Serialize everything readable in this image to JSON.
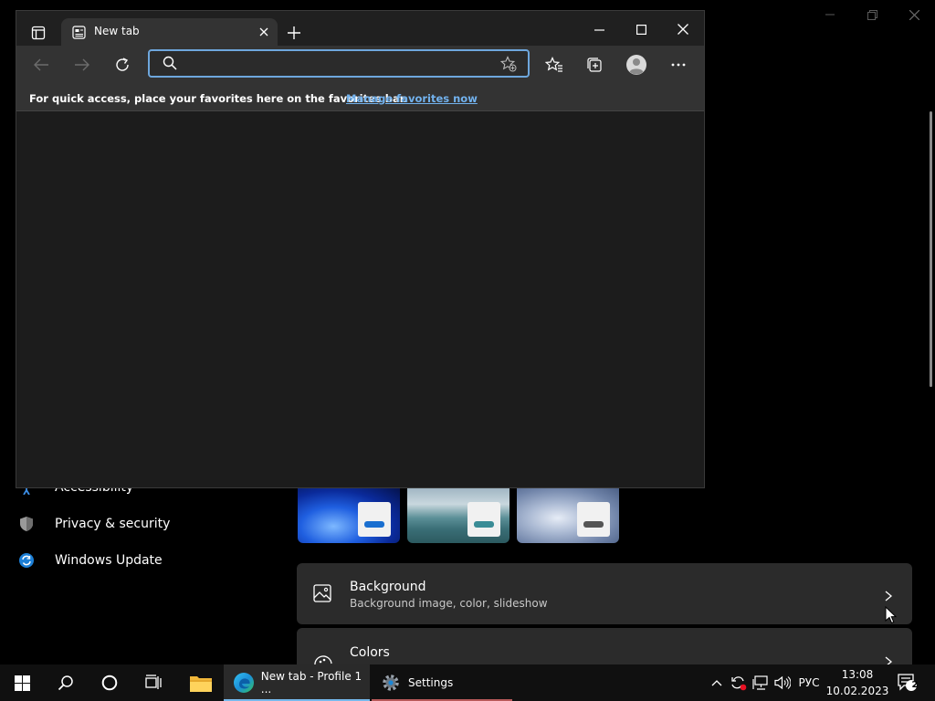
{
  "browser": {
    "tab": {
      "title": "New tab"
    },
    "address": {
      "value": "",
      "placeholder": ""
    },
    "favorites_bar": {
      "message": "For quick access, place your favorites here on the favorites bar.",
      "link": "Manage favorites now"
    }
  },
  "settings": {
    "nav": [
      {
        "label": "Accessibility",
        "icon": "accessibility-icon"
      },
      {
        "label": "Privacy & security",
        "icon": "shield-icon"
      },
      {
        "label": "Windows Update",
        "icon": "update-icon"
      }
    ],
    "cards": [
      {
        "title": "Background",
        "subtitle": "Background image, color, slideshow",
        "icon": "image-icon"
      },
      {
        "title": "Colors",
        "icon": "palette-icon"
      }
    ]
  },
  "taskbar": {
    "apps": [
      {
        "label": "New tab - Profile 1 ...",
        "icon": "edge-icon",
        "active": true
      },
      {
        "label": "Settings",
        "icon": "gear-icon",
        "active": false
      }
    ],
    "language": "РУС",
    "time": "13:08",
    "date": "10.02.2023",
    "notifications": "2"
  },
  "colors": {
    "accent": "#0078d4",
    "link": "#72b2ee",
    "omnibox_focus": "#6ea7dd",
    "recording": "#e81123"
  }
}
